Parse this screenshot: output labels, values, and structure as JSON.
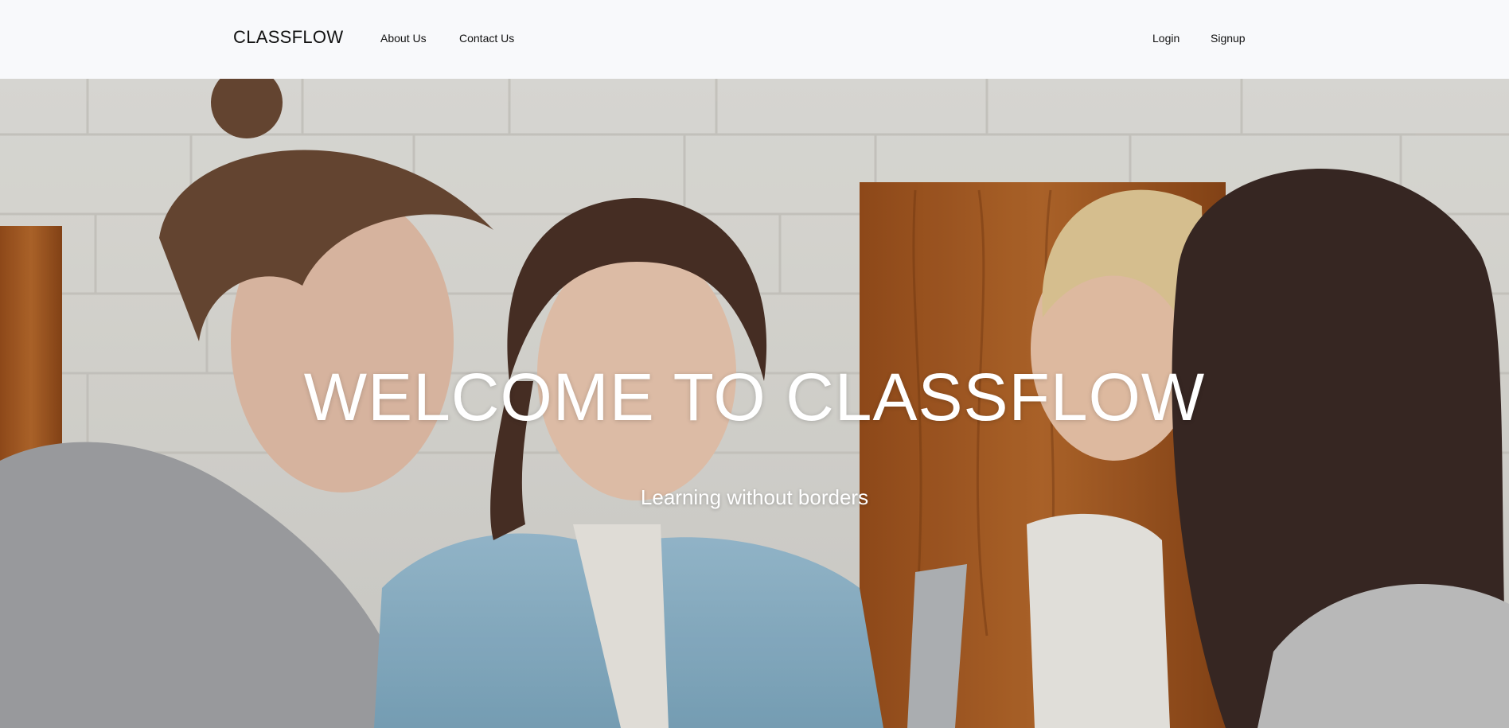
{
  "navbar": {
    "brand": "CLASSFLOW",
    "left_links": [
      "About Us",
      "Contact Us"
    ],
    "right_links": [
      "Login",
      "Signup"
    ]
  },
  "hero": {
    "title": "WELCOME TO CLASSFLOW",
    "subtitle": "Learning without borders",
    "background_image": "photo of four young people smiling around a table in front of a white brick wall"
  },
  "colors": {
    "navbar_bg": "#f8f9fb",
    "nav_text": "#111111",
    "hero_text": "#ffffff"
  }
}
